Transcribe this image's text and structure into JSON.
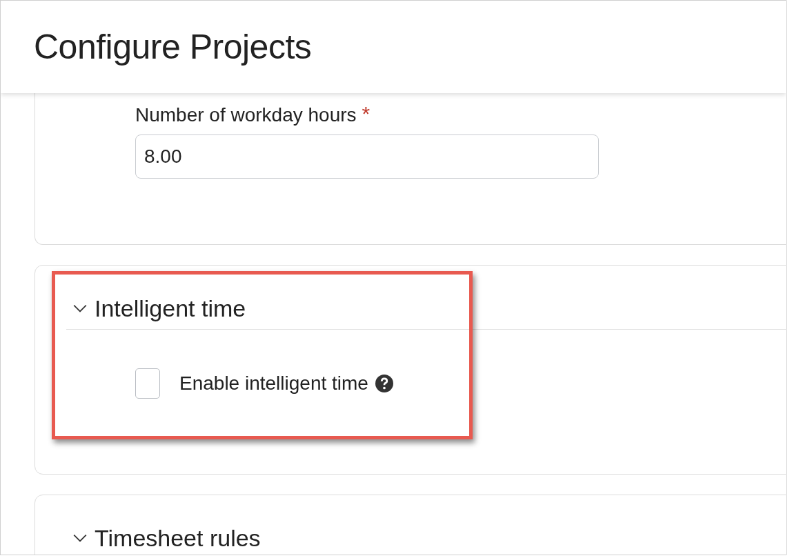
{
  "title": "Configure Projects",
  "workday_hours": {
    "label": "Number of workday hours",
    "required_mark": "*",
    "value": "8.00"
  },
  "sections": [
    {
      "title": "Intelligent time",
      "expanded": true,
      "highlighted": true,
      "options": [
        {
          "label": "Enable intelligent time",
          "checked": false
        }
      ]
    },
    {
      "title": "Timesheet rules",
      "expanded": true,
      "highlighted": false
    }
  ]
}
